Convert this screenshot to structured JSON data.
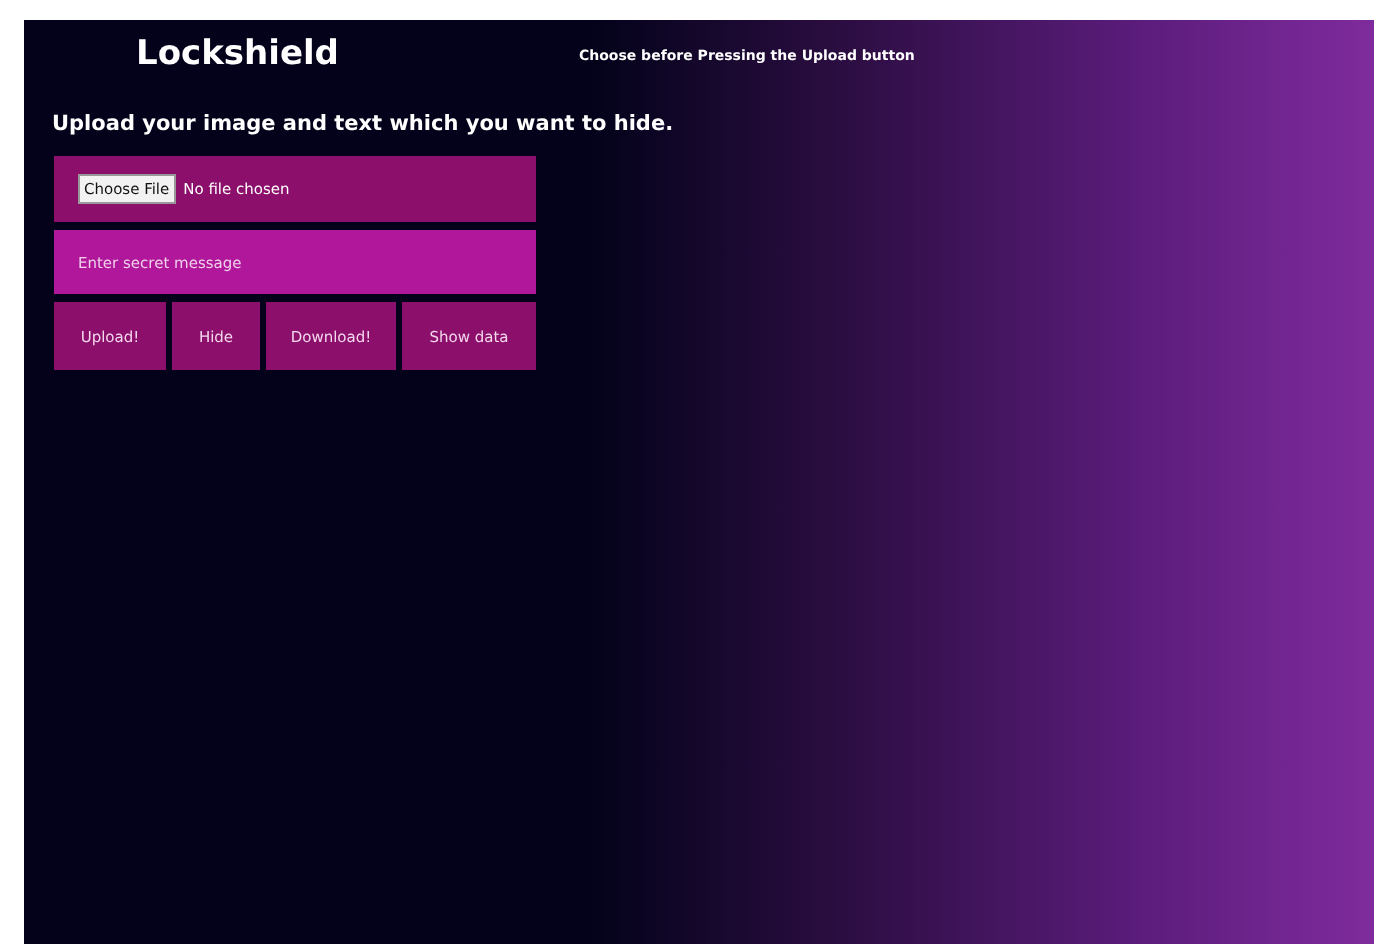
{
  "app_title": "Lockshield",
  "note": "Choose before Pressing the Upload button",
  "heading": "Upload your image and text which you want to hide.",
  "file_input": {
    "button": "Choose File",
    "status": "No file chosen"
  },
  "message_field": {
    "placeholder": "Enter secret message"
  },
  "buttons": [
    "Upload!",
    "Hide",
    "Download!",
    "Show data"
  ]
}
